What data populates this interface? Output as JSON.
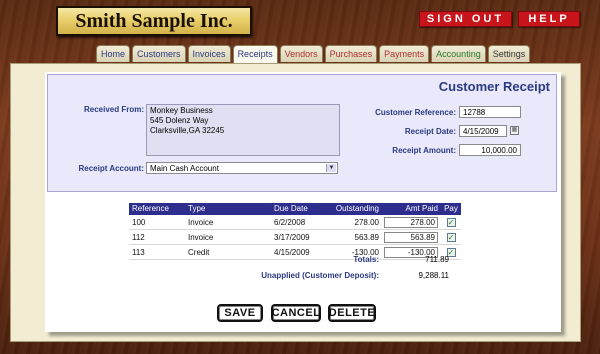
{
  "app": {
    "company_name": "Smith Sample Inc.",
    "sign_out_label": "SIGN OUT",
    "help_label": "HELP"
  },
  "tabs": [
    {
      "label": "Home",
      "active": false
    },
    {
      "label": "Customers",
      "active": false
    },
    {
      "label": "Invoices",
      "active": false
    },
    {
      "label": "Receipts",
      "active": true
    },
    {
      "label": "Vendors",
      "active": false
    },
    {
      "label": "Purchases",
      "active": false
    },
    {
      "label": "Payments",
      "active": false
    },
    {
      "label": "Accounting",
      "active": false
    },
    {
      "label": "Settings",
      "active": false
    }
  ],
  "form": {
    "title": "Customer Receipt",
    "received_from_label": "Received From:",
    "received_from_value": "Monkey Business\n545 Dolenz Way\nClarksville,GA 32245",
    "customer_reference_label": "Customer Reference:",
    "customer_reference_value": "12788",
    "receipt_date_label": "Receipt Date:",
    "receipt_date_value": "4/15/2009",
    "receipt_amount_label": "Receipt Amount:",
    "receipt_amount_value": "10,000.00",
    "receipt_account_label": "Receipt Account:",
    "receipt_account_value": "Main Cash Account"
  },
  "table": {
    "headers": {
      "reference": "Reference",
      "type": "Type",
      "due_date": "Due Date",
      "outstanding": "Outstanding",
      "amt_paid": "Amt Paid",
      "pay": "Pay"
    },
    "rows": [
      {
        "reference": "100",
        "type": "Invoice",
        "due_date": "6/2/2008",
        "outstanding": "278.00",
        "amt_paid": "278.00",
        "pay": "✓"
      },
      {
        "reference": "112",
        "type": "Invoice",
        "due_date": "3/17/2009",
        "outstanding": "563.89",
        "amt_paid": "563.89",
        "pay": "✓"
      },
      {
        "reference": "113",
        "type": "Credit",
        "due_date": "4/15/2009",
        "outstanding": "-130.00",
        "amt_paid": "-130.00",
        "pay": "✓"
      }
    ],
    "totals_label": "Totals:",
    "totals_value": "711.89",
    "unapplied_label": "Unapplied (Customer Deposit):",
    "unapplied_value": "9,288.11"
  },
  "actions": {
    "save_label": "SAVE",
    "cancel_label": "CANCEL",
    "delete_label": "DELETE"
  },
  "icons": {
    "calendar": "calendar-icon",
    "dropdown": "chevron-down-icon",
    "checkbox": "checkmark-icon"
  },
  "colors": {
    "brand_red": "#c8151b",
    "header_blue": "#2d2d8e",
    "label_blue": "#2b3a82"
  }
}
